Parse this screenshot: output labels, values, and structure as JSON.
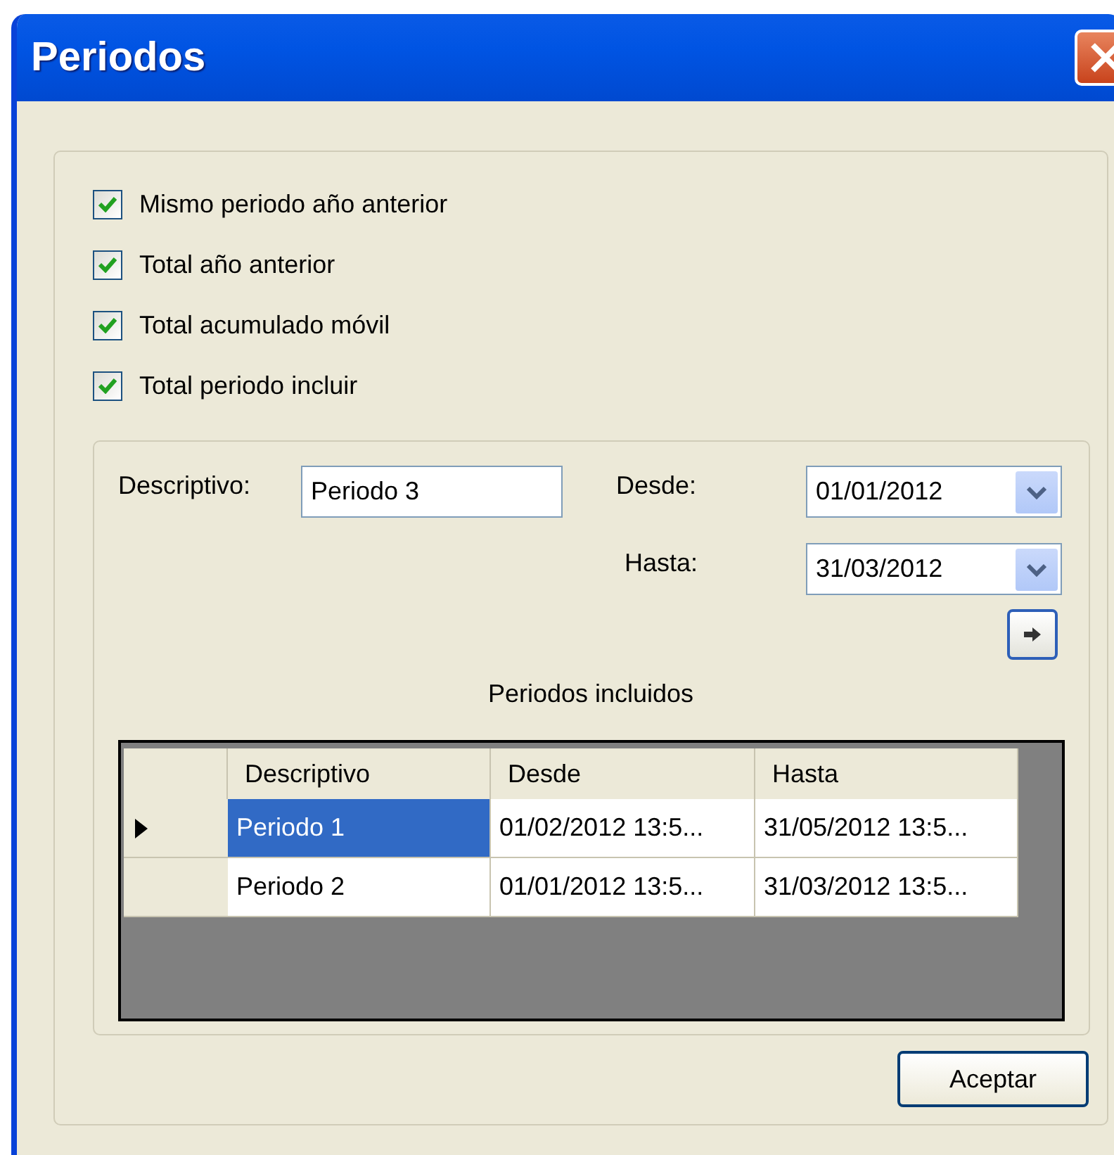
{
  "window": {
    "title": "Periodos"
  },
  "options": [
    {
      "label": "Mismo periodo año anterior",
      "checked": true
    },
    {
      "label": "Total año anterior",
      "checked": true
    },
    {
      "label": "Total acumulado móvil",
      "checked": true
    },
    {
      "label": "Total periodo incluir",
      "checked": true
    }
  ],
  "form": {
    "descriptivo_label": "Descriptivo:",
    "descriptivo_value": "Periodo 3",
    "desde_label": "Desde:",
    "desde_value": "01/01/2012",
    "hasta_label": "Hasta:",
    "hasta_value": "31/03/2012"
  },
  "table": {
    "title": "Periodos incluidos",
    "columns": [
      "Descriptivo",
      "Desde",
      "Hasta"
    ],
    "rows": [
      {
        "current": true,
        "selected": true,
        "cells": [
          "Periodo 1",
          "01/02/2012 13:5...",
          "31/05/2012 13:5..."
        ]
      },
      {
        "current": false,
        "selected": false,
        "cells": [
          "Periodo 2",
          "01/01/2012 13:5...",
          "31/03/2012 13:5..."
        ]
      }
    ]
  },
  "buttons": [
    "Aceptar"
  ]
}
